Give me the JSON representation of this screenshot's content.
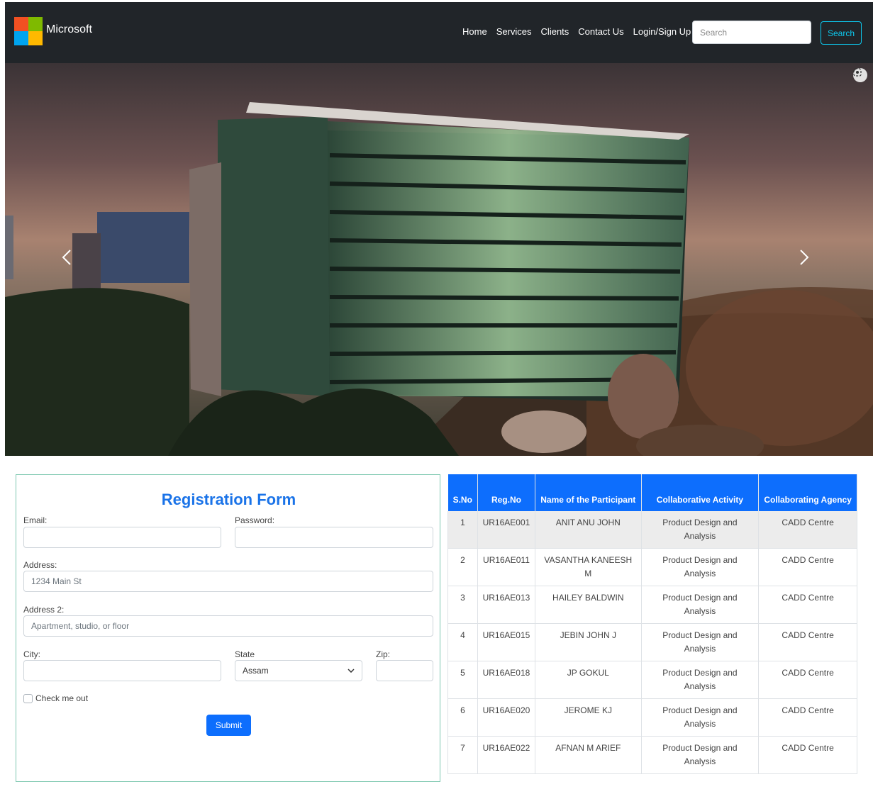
{
  "navbar": {
    "brand": "Microsoft",
    "links": [
      "Home",
      "Services",
      "Clients",
      "Contact Us",
      "Login/Sign Up"
    ],
    "search_placeholder": "Search",
    "search_button": "Search"
  },
  "hero": {
    "prev_icon": "chevron-left-icon",
    "next_icon": "chevron-right-icon"
  },
  "form": {
    "title": "Registration Form",
    "email_label": "Email:",
    "password_label": "Password:",
    "address_label": "Address:",
    "address_placeholder": "1234 Main St",
    "address2_label": "Address 2:",
    "address2_placeholder": "Apartment, studio, or floor",
    "city_label": "City:",
    "state_label": "State",
    "state_selected": "Assam",
    "zip_label": "Zip:",
    "checkbox_label": "Check me out",
    "submit_label": "Submit"
  },
  "table": {
    "headers": [
      "S.No",
      "Reg.No",
      "Name of the Participant",
      "Collaborative Activity",
      "Collaborating Agency"
    ],
    "rows": [
      [
        "1",
        "UR16AE001",
        "ANIT ANU JOHN",
        "Product Design and Analysis",
        "CADD Centre"
      ],
      [
        "2",
        "UR16AE011",
        "VASANTHA KANEESH M",
        "Product Design and Analysis",
        "CADD Centre"
      ],
      [
        "3",
        "UR16AE013",
        "HAILEY BALDWIN",
        "Product Design and Analysis",
        "CADD Centre"
      ],
      [
        "4",
        "UR16AE015",
        "JEBIN JOHN J",
        "Product Design and Analysis",
        "CADD Centre"
      ],
      [
        "5",
        "UR16AE018",
        "JP GOKUL",
        "Product Design and Analysis",
        "CADD Centre"
      ],
      [
        "6",
        "UR16AE020",
        "JEROME KJ",
        "Product Design and Analysis",
        "CADD Centre"
      ],
      [
        "7",
        "UR16AE022",
        "AFNAN M ARIEF",
        "Product Design and Analysis",
        "CADD Centre"
      ]
    ]
  },
  "colors": {
    "navbar_bg": "#212529",
    "primary": "#0d6efd",
    "search_outline": "#0dcaf0",
    "title_blue": "#1a73e8"
  }
}
